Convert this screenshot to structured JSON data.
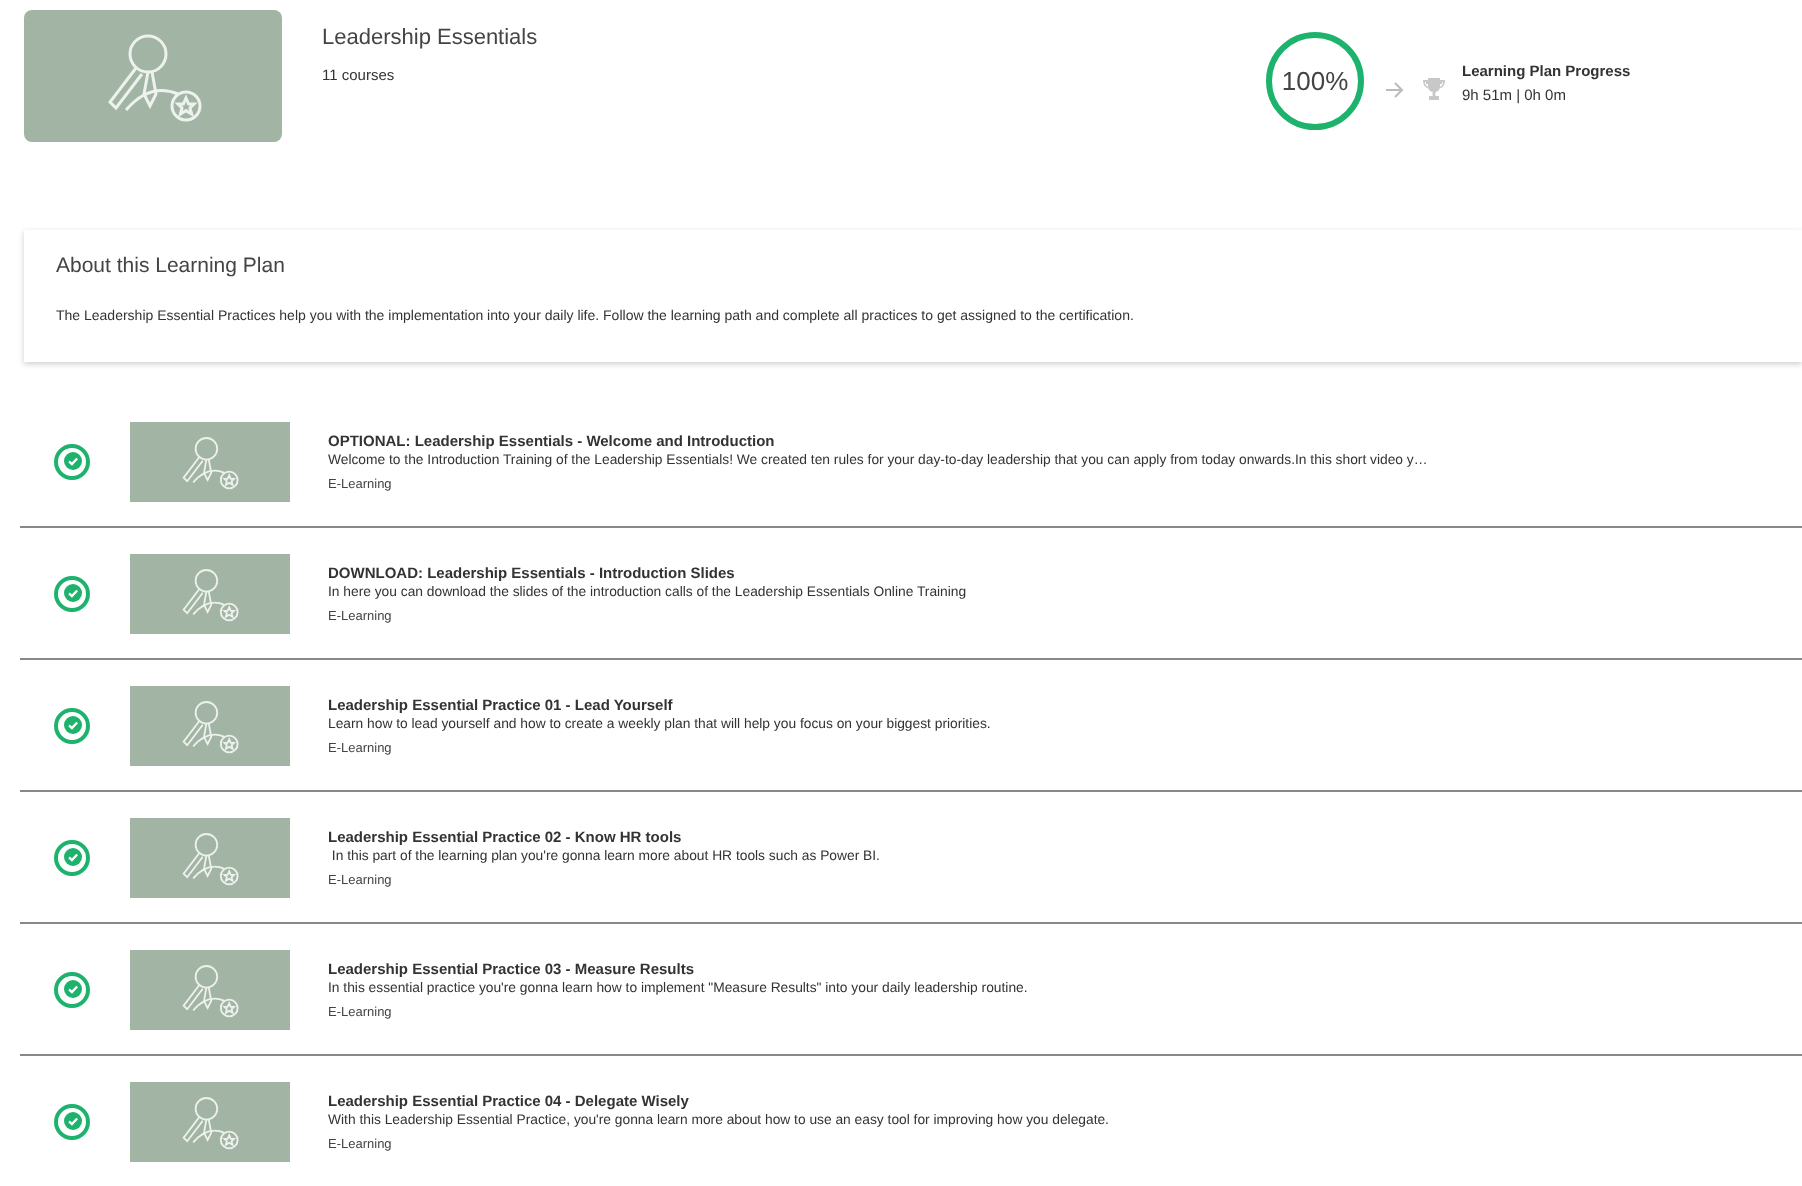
{
  "plan": {
    "title": "Leadership Essentials",
    "course_count": "11 courses"
  },
  "progress": {
    "percent": "100%",
    "label": "Learning Plan Progress",
    "time": "9h 51m | 0h 0m"
  },
  "about": {
    "heading": "About this Learning Plan",
    "text": "The Leadership Essential Practices help you with the implementation into your daily life. Follow the learning path and complete all practices to get assigned to the certification."
  },
  "courses": [
    {
      "title": "OPTIONAL: Leadership Essentials - Welcome and Introduction",
      "description": "Welcome to the Introduction Training of the Leadership Essentials! We created ten rules for your day-to-day leadership that you can apply from today onwards.In this short video y…",
      "type": "E-Learning",
      "completed": true
    },
    {
      "title": "DOWNLOAD: Leadership Essentials - Introduction Slides",
      "description": "In here you can download the slides of the introduction calls of the Leadership Essentials Online Training",
      "type": "E-Learning",
      "completed": true
    },
    {
      "title": "Leadership Essential Practice 01 - Lead Yourself",
      "description": "Learn how to lead yourself and how to create a weekly plan that will help you focus on your biggest priorities.",
      "type": "E-Learning",
      "completed": true
    },
    {
      "title": "Leadership Essential Practice 02 - Know HR tools",
      "description": " In this part of the learning plan you're gonna learn more about HR tools such as Power BI.",
      "type": "E-Learning",
      "completed": true
    },
    {
      "title": "Leadership Essential Practice 03 - Measure Results",
      "description": "In this essential practice you're gonna learn how to implement \"Measure Results\" into your daily leadership routine.",
      "type": "E-Learning",
      "completed": true
    },
    {
      "title": "Leadership Essential Practice 04 - Delegate Wisely",
      "description": "With this Leadership Essential Practice, you're gonna learn more about how to use an easy tool for improving how you delegate.",
      "type": "E-Learning",
      "completed": true
    }
  ]
}
